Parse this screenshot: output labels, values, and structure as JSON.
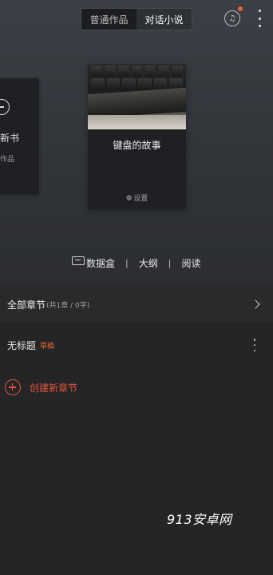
{
  "header": {
    "tabs": [
      {
        "label": "普通作品",
        "active": true
      },
      {
        "label": "对话小说",
        "active": false
      }
    ],
    "icon_text": "♫"
  },
  "left_card": {
    "new_chapter_label": "新书",
    "works_label": "作品"
  },
  "book": {
    "title": "键盘的故事",
    "settings_label": "设置"
  },
  "toolbar": {
    "items": [
      "数据盒",
      "大纲",
      "阅读"
    ],
    "separator": "|"
  },
  "chapters": {
    "all_label": "全部章节",
    "count_text": "(共1章 / 0字)",
    "rows": [
      {
        "title": "无标题",
        "badge": "草稿"
      }
    ],
    "create_label": "创建新章节"
  },
  "watermark": "913安卓网",
  "colors": {
    "accent": "#e0543a",
    "draft": "#e8662f",
    "background": "#252527"
  }
}
